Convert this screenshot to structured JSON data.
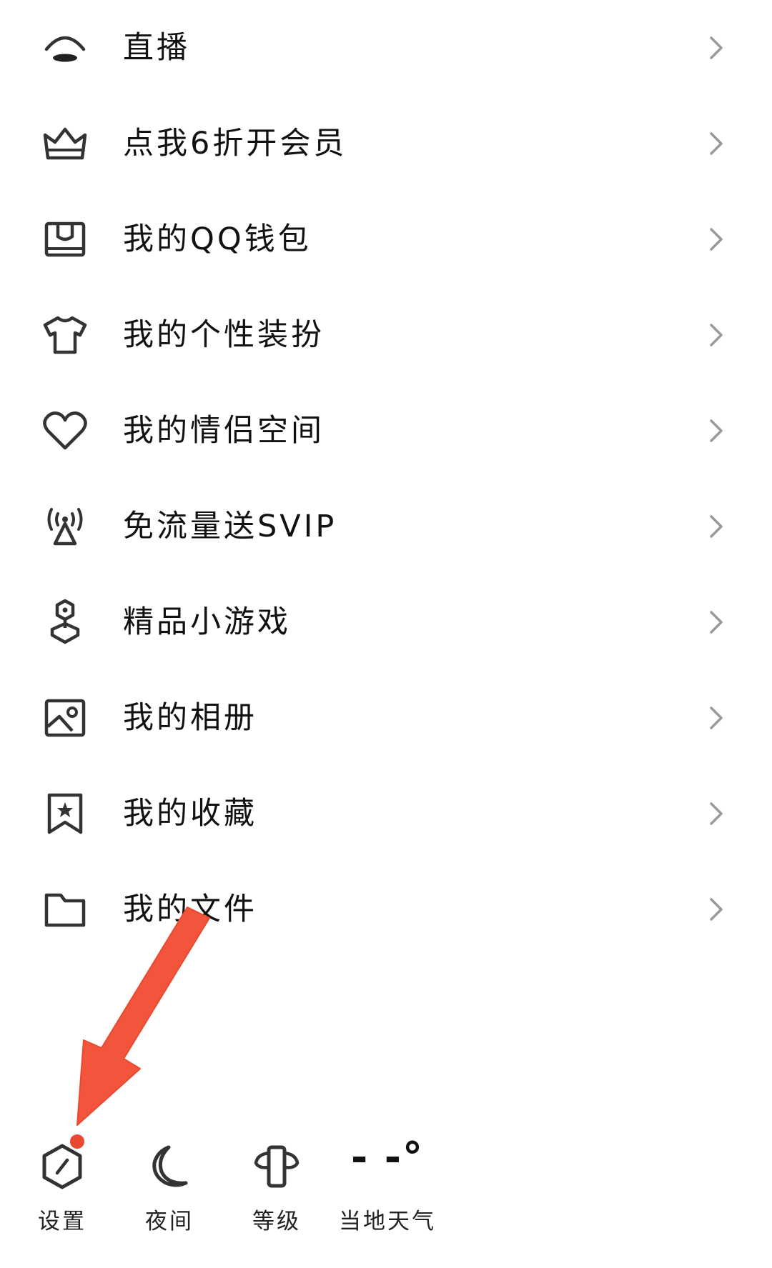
{
  "menu": {
    "items": [
      {
        "label": "直播",
        "icon": "live-icon"
      },
      {
        "label": "点我6折开会员",
        "icon": "crown-icon"
      },
      {
        "label": "我的QQ钱包",
        "icon": "wallet-icon"
      },
      {
        "label": "我的个性装扮",
        "icon": "shirt-icon"
      },
      {
        "label": "我的情侣空间",
        "icon": "heart-icon"
      },
      {
        "label": "免流量送SVIP",
        "icon": "signal-tower-icon"
      },
      {
        "label": "精品小游戏",
        "icon": "game-icon"
      },
      {
        "label": "我的相册",
        "icon": "photo-album-icon"
      },
      {
        "label": "我的收藏",
        "icon": "bookmark-star-icon"
      },
      {
        "label": "我的文件",
        "icon": "folder-icon"
      }
    ]
  },
  "bottom_bar": {
    "settings_label": "设置",
    "night_label": "夜间",
    "level_label": "等级",
    "weather_label": "当地天气",
    "weather_temp": "- -°"
  },
  "colors": {
    "icon": "#333333",
    "chevron": "#9a9a9a",
    "annotation": "#f2553b"
  }
}
